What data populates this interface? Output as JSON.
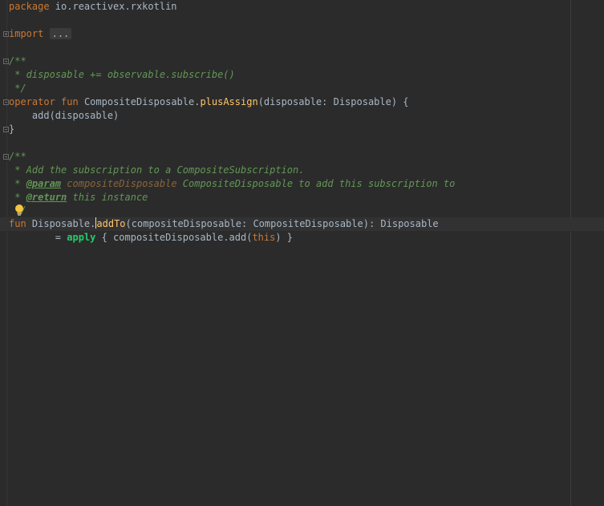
{
  "code": {
    "line_package_kw": "package",
    "line_package_name": " io.reactivex.rxkotlin",
    "line_import_kw": "import",
    "line_import_fold": "...",
    "doc1_open": "/**",
    "doc1_text": " * disposable += observable.subscribe()",
    "doc1_close": " */",
    "op_kw": "operator",
    "op_fun": "fun",
    "op_receiver": " CompositeDisposable.",
    "op_name": "plusAssign",
    "op_params": "(disposable: Disposable) {",
    "op_body": "    add(disposable)",
    "op_close": "}",
    "doc2_open": "/**",
    "doc2_text": " * Add the subscription to a CompositeSubscription.",
    "doc2_param_prefix": " * ",
    "doc2_param_tag": "@param",
    "doc2_param_name": "compositeDisposable",
    "doc2_param_text": " CompositeDisposable to add this subscription to",
    "doc2_return_prefix": " * ",
    "doc2_return_tag": "@return",
    "doc2_return_text": " this instance",
    "doc2_close": " */",
    "fun_kw": "fun",
    "fun_receiver": " Disposable.",
    "fun_name": "addTo",
    "fun_sig": "(compositeDisposable: CompositeDisposable): Disposable",
    "body_prefix": "        = ",
    "body_apply": "apply",
    "body_open": " { compositeDisposable.add(",
    "body_this": "this",
    "body_close": ") }"
  },
  "colors": {
    "background": "#2b2b2b",
    "keyword": "#cc7832",
    "function": "#ffc66d",
    "comment": "#629755",
    "text": "#a9b7c6",
    "apply": "#23ce6b"
  },
  "icons": [
    "lightbulb-icon",
    "fold-icon"
  ]
}
